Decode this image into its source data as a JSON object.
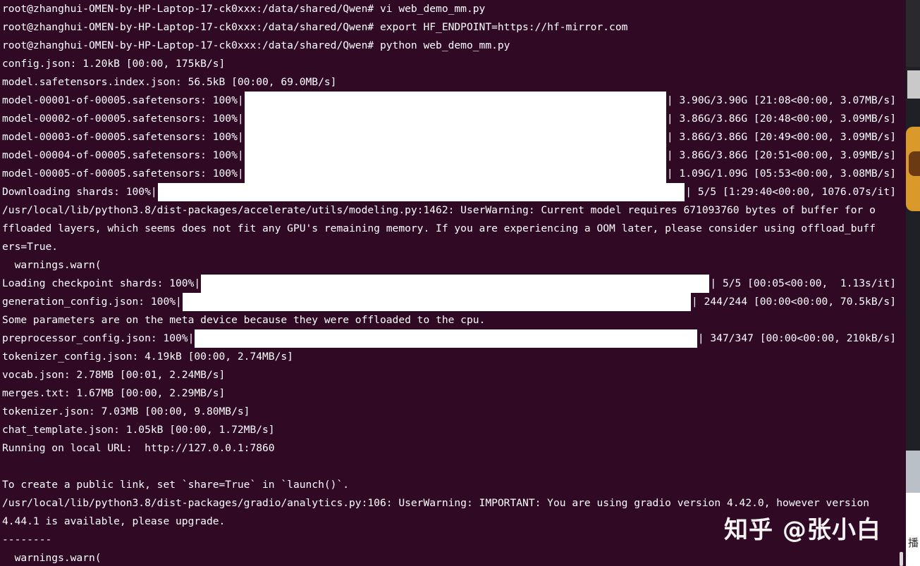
{
  "terminal": {
    "lines": [
      {
        "text": "root@zhanghui-OMEN-by-HP-Laptop-17-ck0xxx:/data/shared/Qwen# vi web_demo_mm.py"
      },
      {
        "text": "root@zhanghui-OMEN-by-HP-Laptop-17-ck0xxx:/data/shared/Qwen# export HF_ENDPOINT=https://hf-mirror.com"
      },
      {
        "text": "root@zhanghui-OMEN-by-HP-Laptop-17-ck0xxx:/data/shared/Qwen# python web_demo_mm.py"
      },
      {
        "text": "config.json: 1.20kB [00:00, 175kB/s]"
      },
      {
        "text": "model.safetensors.index.json: 56.5kB [00:00, 69.0MB/s]"
      },
      {
        "pre": "model-00001-of-00005.safetensors: 100%|",
        "post": "| 3.90G/3.90G [21:08<00:00, 3.07MB/s]",
        "progress": 1.0
      },
      {
        "pre": "model-00002-of-00005.safetensors: 100%|",
        "post": "| 3.86G/3.86G [20:48<00:00, 3.09MB/s]",
        "progress": 1.0
      },
      {
        "pre": "model-00003-of-00005.safetensors: 100%|",
        "post": "| 3.86G/3.86G [20:49<00:00, 3.09MB/s]",
        "progress": 1.0
      },
      {
        "pre": "model-00004-of-00005.safetensors: 100%|",
        "post": "| 3.86G/3.86G [20:51<00:00, 3.09MB/s]",
        "progress": 1.0
      },
      {
        "pre": "model-00005-of-00005.safetensors: 100%|",
        "post": "| 1.09G/1.09G [05:53<00:00, 3.08MB/s]",
        "progress": 1.0
      },
      {
        "pre": "Downloading shards: 100%|",
        "post": "| 5/5 [1:29:40<00:00, 1076.07s/it]",
        "progress": 1.0
      },
      {
        "text": "/usr/local/lib/python3.8/dist-packages/accelerate/utils/modeling.py:1462: UserWarning: Current model requires 671093760 bytes of buffer for o"
      },
      {
        "text": "ffloaded layers, which seems does not fit any GPU's remaining memory. If you are experiencing a OOM later, please consider using offload_buff"
      },
      {
        "text": "ers=True."
      },
      {
        "text": "  warnings.warn("
      },
      {
        "pre": "Loading checkpoint shards: 100%|",
        "post": "| 5/5 [00:05<00:00,  1.13s/it]",
        "progress": 1.0
      },
      {
        "pre": "generation_config.json: 100%|",
        "post": "| 244/244 [00:00<00:00, 70.5kB/s]",
        "progress": 1.0
      },
      {
        "text": "Some parameters are on the meta device because they were offloaded to the cpu."
      },
      {
        "pre": "preprocessor_config.json: 100%|",
        "post": "| 347/347 [00:00<00:00, 210kB/s]",
        "progress": 1.0
      },
      {
        "text": "tokenizer_config.json: 4.19kB [00:00, 2.74MB/s]"
      },
      {
        "text": "vocab.json: 2.78MB [00:01, 2.24MB/s]"
      },
      {
        "text": "merges.txt: 1.67MB [00:00, 2.29MB/s]"
      },
      {
        "text": "tokenizer.json: 7.03MB [00:00, 9.80MB/s]"
      },
      {
        "text": "chat_template.json: 1.05kB [00:00, 1.72MB/s]"
      },
      {
        "text": "Running on local URL:  http://127.0.0.1:7860"
      },
      {
        "text": ""
      },
      {
        "text": "To create a public link, set `share=True` in `launch()`."
      },
      {
        "text": "/usr/local/lib/python3.8/dist-packages/gradio/analytics.py:106: UserWarning: IMPORTANT: You are using gradio version 4.42.0, however version"
      },
      {
        "text": "4.44.1 is available, please upgrade."
      },
      {
        "text": "--------"
      },
      {
        "text": "  warnings.warn("
      }
    ]
  },
  "watermark": {
    "text": "知乎 @张小白"
  },
  "side": {
    "partial_text": "播"
  },
  "colors": {
    "terminal_bg": "#300a24",
    "text": "#ffffff",
    "progress_fill": "#ffffff"
  }
}
